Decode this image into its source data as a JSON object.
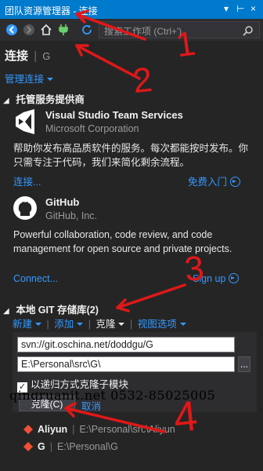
{
  "window": {
    "title": "团队资源管理器 - 连接",
    "pin_glyph": "▾",
    "pin2_glyph": "⊢",
    "close_glyph": "×"
  },
  "toolbar": {
    "search_placeholder": "搜索工作项 (Ctrl+')"
  },
  "header": {
    "title": "连接",
    "separator": "|",
    "subtitle": "G",
    "manage_link": "管理连接"
  },
  "hosted": {
    "section_title": "托管服务提供商",
    "vsts": {
      "name": "Visual Studio Team Services",
      "org": "Microsoft Corporation",
      "desc": "帮助你发布高品质软件的服务。每次都能按时发布。你只需专注于代码，我们来简化剩余流程。",
      "connect": "连接...",
      "signup": "免费入门"
    },
    "github": {
      "name": "GitHub",
      "org": "GitHub, Inc.",
      "desc": "Powerful collaboration, code review, and code management for open source and private projects.",
      "connect": "Connect...",
      "signup": "Sign up"
    }
  },
  "local": {
    "section_title": "本地 GIT 存储库(2)",
    "actions": [
      "新建",
      "添加",
      "克隆",
      "视图选项"
    ],
    "clone_url": "svn://git.oschina.net/doddgu/G",
    "clone_path": "E:\\Personal\\src\\G\\",
    "browse_label": "...",
    "recursive_label": "以递归方式克隆子模块",
    "clone_button": "克隆(C)",
    "cancel_link": "取消",
    "repos": [
      {
        "name": "Aliyun",
        "path": "E:\\Personal\\src\\Aliyun"
      },
      {
        "name": "G",
        "path": "E:\\Personal\\G"
      }
    ]
  },
  "overlay": {
    "watermark": "qingruanit.net 0532-85025005",
    "annotations": [
      "1",
      "2",
      "3",
      "4"
    ]
  },
  "colors": {
    "accent": "#007acc",
    "link": "#3399ff",
    "background": "#252526",
    "annotation": "#e01818"
  },
  "icons": [
    "back-icon",
    "forward-icon",
    "home-icon",
    "plug-icon",
    "refresh-icon",
    "search-icon",
    "vsts-logo-icon",
    "github-logo-icon",
    "git-repo-icon"
  ]
}
